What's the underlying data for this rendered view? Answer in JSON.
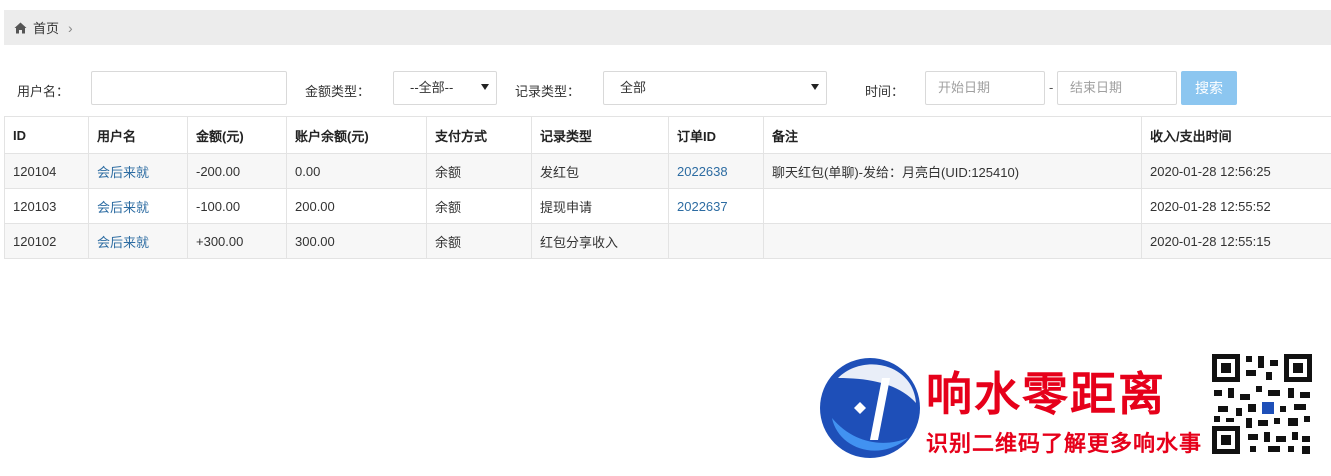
{
  "breadcrumb": {
    "home_label": "首页",
    "separator": "›"
  },
  "filters": {
    "username_label": "用户名：",
    "username_value": "",
    "amount_type_label": "金额类型：",
    "amount_type_selected": "--全部--",
    "record_type_label": "记录类型：",
    "record_type_selected": "全部",
    "time_label": "时间：",
    "start_date_placeholder": "开始日期",
    "date_separator": "-",
    "end_date_placeholder": "结束日期",
    "search_button": "搜索"
  },
  "table": {
    "headers": [
      "ID",
      "用户名",
      "金额(元)",
      "账户余额(元)",
      "支付方式",
      "记录类型",
      "订单ID",
      "备注",
      "收入/支出时间"
    ],
    "rows": [
      [
        "120104",
        "会后来就",
        "-200.00",
        "0.00",
        "余额",
        "发红包",
        "2022638",
        "聊天红包(单聊)-发给：月亮白(UID:125410)",
        "2020-01-28 12:56:25"
      ],
      [
        "120103",
        "会后来就",
        "-100.00",
        "200.00",
        "余额",
        "提现申请",
        "2022637",
        "",
        "2020-01-28 12:55:52"
      ],
      [
        "120102",
        "会后来就",
        "+300.00",
        "300.00",
        "余额",
        "红包分享收入",
        "",
        "",
        "2020-01-28 12:55:15"
      ]
    ]
  },
  "watermark": {
    "title": "响水零距离",
    "subtitle": "识别二维码了解更多响水事"
  },
  "colors": {
    "link": "#2d6ca2",
    "search_button": "#8cc6f0",
    "watermark_red": "#e6001a",
    "watermark_blue": "#1e4fb8"
  }
}
